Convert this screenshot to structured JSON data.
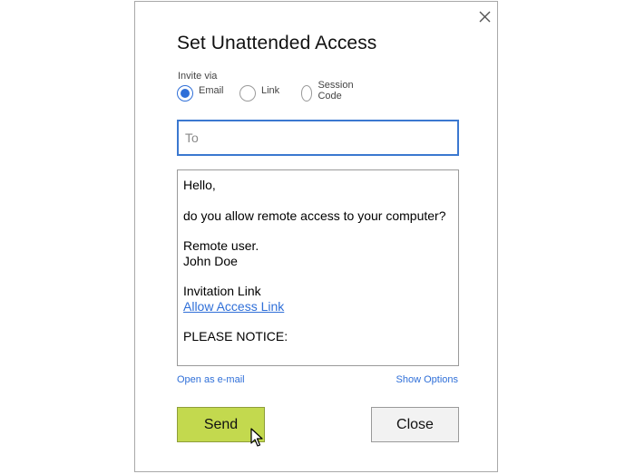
{
  "dialog": {
    "title": "Set Unattended Access",
    "invite_via_label": "Invite via",
    "radio_options": [
      {
        "label": "Email",
        "checked": true
      },
      {
        "label": "Link",
        "checked": false
      },
      {
        "label": "Session Code",
        "checked": false
      }
    ],
    "to_field": {
      "placeholder": "To",
      "value": ""
    },
    "message": {
      "greeting": "Hello,",
      "question": "do you allow remote access to your computer?",
      "signature_line1": "Remote user.",
      "signature_line2": "John Doe",
      "invitation_label": "Invitation Link",
      "link_text": "Allow Access Link",
      "notice": "PLEASE NOTICE:"
    },
    "open_email_link": "Open as e-mail",
    "show_options_link": "Show Options",
    "send_label": "Send",
    "close_label": "Close"
  },
  "colors": {
    "accent": "#2f6fd8",
    "send_button": "#c3d94e",
    "close_button": "#f2f2f2"
  },
  "icons": {
    "close": "close-icon",
    "cursor": "mouse-pointer-icon"
  }
}
